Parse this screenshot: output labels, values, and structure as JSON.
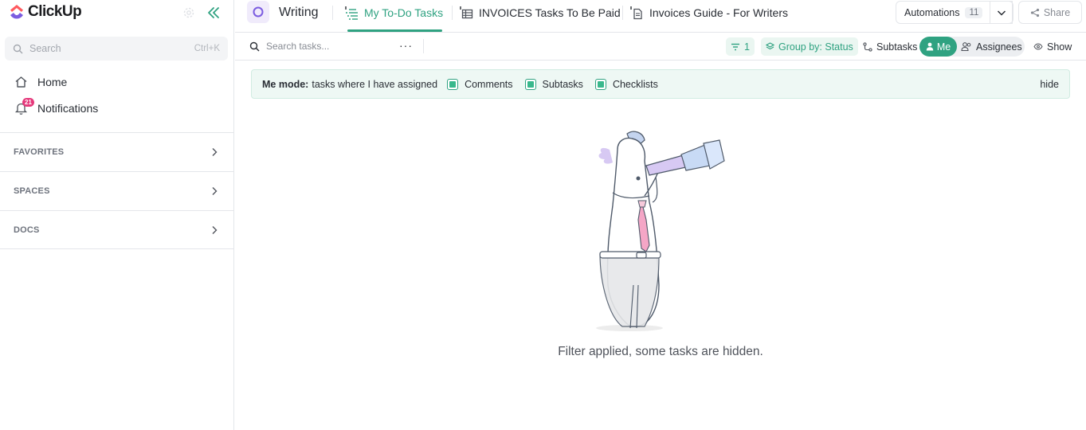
{
  "sidebar": {
    "logo_text": "ClickUp",
    "search_placeholder": "Search",
    "search_shortcut": "Ctrl+K",
    "nav": [
      {
        "label": "Home",
        "icon": "home-icon"
      },
      {
        "label": "Notifications",
        "icon": "bell-icon",
        "badge": "21"
      }
    ],
    "sections": [
      "FAVORITES",
      "SPACES",
      "DOCS"
    ]
  },
  "header": {
    "space_name": "Writing",
    "tabs": [
      {
        "label": "My To-Do Tasks",
        "icon": "list-icon",
        "active": true
      },
      {
        "label": "INVOICES Tasks To Be Paid",
        "icon": "table-icon",
        "active": false
      },
      {
        "label": "Invoices Guide - For Writers",
        "icon": "doc-icon",
        "active": false
      }
    ],
    "automations_label": "Automations",
    "automations_count": "11",
    "share_label": "Share"
  },
  "toolbar": {
    "search_placeholder": "Search tasks...",
    "more_label": "···",
    "filter_count": "1",
    "group_by_label": "Group by: Status",
    "subtasks_label": "Subtasks",
    "me_label": "Me",
    "assignees_label": "Assignees",
    "show_label": "Show"
  },
  "banner": {
    "title": "Me mode:",
    "text": "tasks where I have assigned",
    "options": [
      {
        "label": "Comments",
        "checked": true
      },
      {
        "label": "Subtasks",
        "checked": true
      },
      {
        "label": "Checklists",
        "checked": true
      }
    ],
    "hide_label": "hide"
  },
  "empty_state": {
    "message": "Filter applied, some tasks are hidden."
  },
  "colors": {
    "accent": "#2fa281",
    "badge": "#e5397b",
    "space_purple": "#7b5ce0"
  }
}
